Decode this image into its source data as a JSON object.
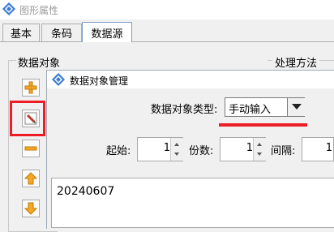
{
  "window": {
    "title": "图形属性"
  },
  "tabs": [
    {
      "label": "基本"
    },
    {
      "label": "条码"
    },
    {
      "label": "数据源",
      "active": true
    }
  ],
  "groups": {
    "data_objects": "数据对象",
    "processing": "处理方法"
  },
  "dialog": {
    "title": "数据对象管理",
    "type_label": "数据对象类型:",
    "type_value": "手动输入",
    "start_label": "起始:",
    "start_value": "1",
    "copies_label": "份数:",
    "copies_value": "1",
    "interval_label": "间隔:",
    "interval_value": "1",
    "content": "20240607"
  },
  "colors": {
    "highlight": "#ee1c25",
    "add": "#f5a623",
    "edit": "#c0392b"
  },
  "icons": [
    "app-icon",
    "add-icon",
    "edit-icon",
    "remove-icon",
    "move-up-icon",
    "move-down-icon",
    "dropdown-arrow-icon"
  ]
}
